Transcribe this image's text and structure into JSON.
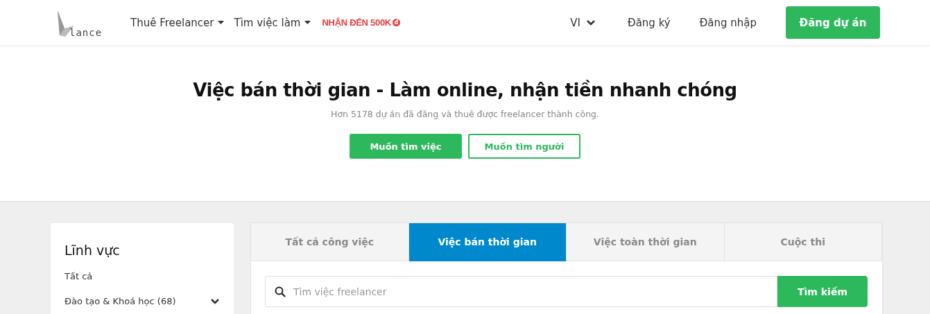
{
  "header": {
    "logo_text": "lance",
    "nav": [
      {
        "label": "Thuê Freelancer",
        "kind": "dropdown"
      },
      {
        "label": "Tìm việc làm",
        "kind": "dropdown"
      }
    ],
    "promo": {
      "label": "NHẬN ĐẾN 500K",
      "currency": "đ"
    },
    "language": "VI",
    "links": [
      "Đăng ký",
      "Đăng nhập"
    ],
    "cta": "Đăng dự án"
  },
  "hero": {
    "title": "Việc bán thời gian - Làm online, nhận tiền nhanh chóng",
    "subtitle": "Hơn 5178 dự án đã đăng và thuê được freelancer thành công.",
    "buttons": [
      {
        "label": "Muốn tìm việc",
        "kind": "primary"
      },
      {
        "label": "Muốn tìm người",
        "kind": "outline"
      }
    ]
  },
  "sidebar": {
    "title": "Lĩnh vực",
    "items": [
      {
        "label": "Tất cả",
        "kind": "link"
      },
      {
        "label": "Đào tạo & Khoá học (68)",
        "kind": "group"
      }
    ]
  },
  "tabs": [
    {
      "label": "Tất cả công việc",
      "selected": false
    },
    {
      "label": "Việc bán thời gian",
      "selected": true
    },
    {
      "label": "Việc toàn thời gian",
      "selected": false
    },
    {
      "label": "Cuộc thi",
      "selected": false
    }
  ],
  "search": {
    "placeholder": "Tìm việc freelancer",
    "button": "Tìm kiếm"
  }
}
